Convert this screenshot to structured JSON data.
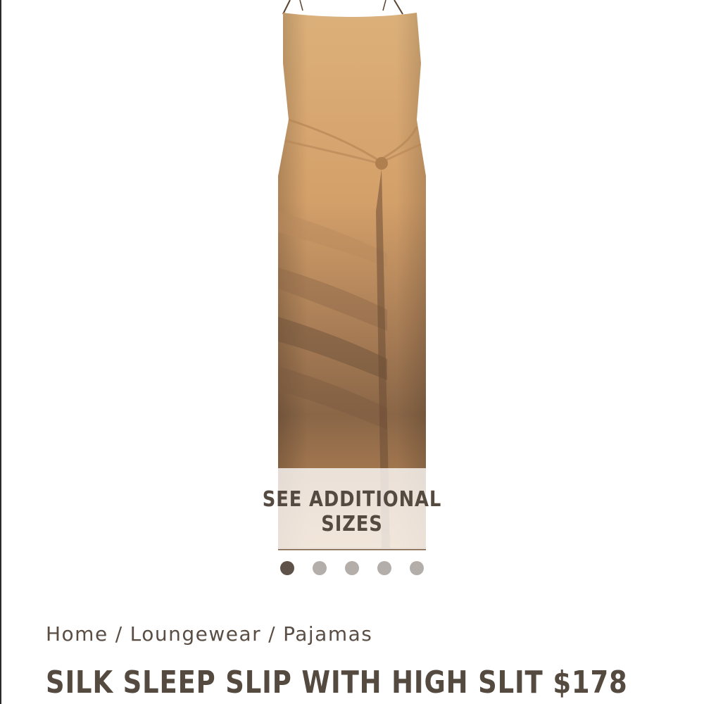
{
  "gallery": {
    "see_sizes_label": "SEE ADDITIONAL SIZES",
    "slide_count": 5,
    "active_slide": 1
  },
  "breadcrumb": {
    "items": [
      "Home",
      "Loungewear",
      "Pajamas"
    ],
    "separator": "/"
  },
  "product": {
    "title": "SILK SLEEP SLIP WITH HIGH SLIT",
    "price": "$178"
  },
  "colors": {
    "text": "#554a40",
    "dot_active": "#5f5349",
    "dot_inactive": "#b3aeaa",
    "fabric_light": "#d9a86e",
    "fabric_dark": "#7a5a3e"
  }
}
